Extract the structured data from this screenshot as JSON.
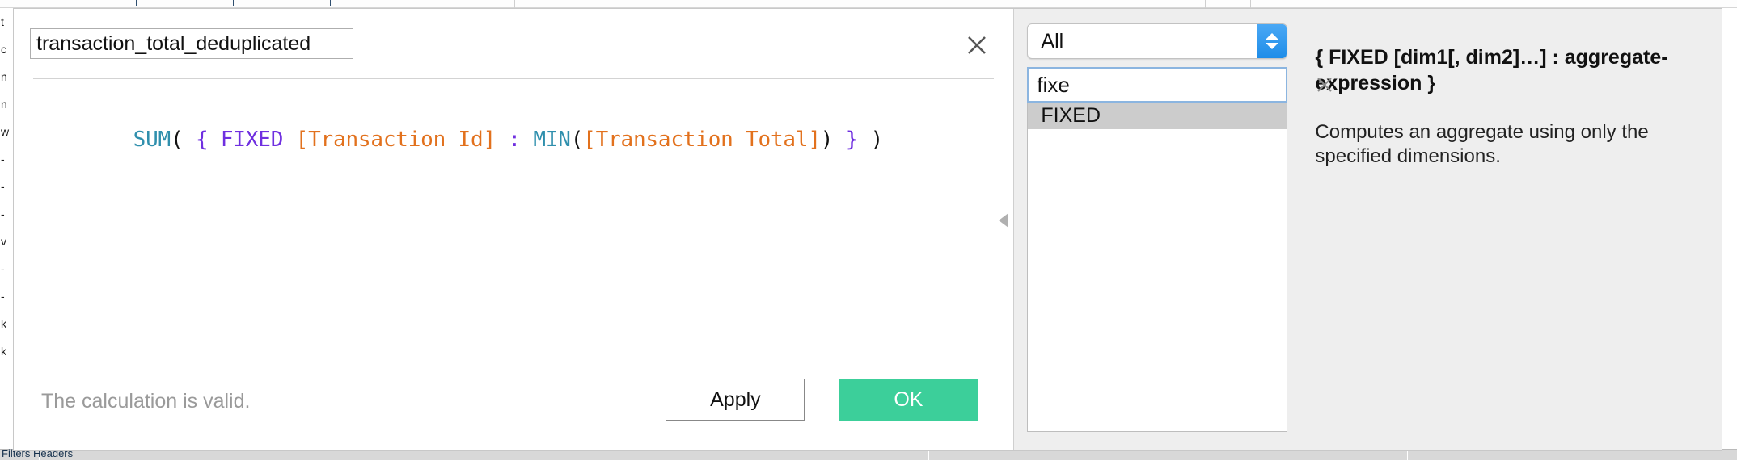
{
  "background": {
    "left_column_fragments": [
      "t",
      "c",
      "n",
      "n",
      "w",
      "-",
      "-",
      "-",
      "v",
      "-",
      "-",
      "k",
      "k"
    ],
    "bottom_label": "Filters Headers"
  },
  "dialog": {
    "name_field": {
      "value": "transaction_total_deduplicated",
      "placeholder": "Calculation name"
    },
    "close_icon": "close-icon",
    "collapse_icon": "collapse-left-arrow-icon",
    "formula": {
      "tokens": [
        {
          "text": "SUM",
          "type": "func"
        },
        {
          "text": "(",
          "type": "punct"
        },
        {
          "text": " ",
          "type": "punct"
        },
        {
          "text": "{",
          "type": "kw"
        },
        {
          "text": " ",
          "type": "punct"
        },
        {
          "text": "FIXED",
          "type": "kw"
        },
        {
          "text": " ",
          "type": "punct"
        },
        {
          "text": "[Transaction Id]",
          "type": "field"
        },
        {
          "text": " ",
          "type": "punct"
        },
        {
          "text": ":",
          "type": "colon"
        },
        {
          "text": " ",
          "type": "punct"
        },
        {
          "text": "MIN",
          "type": "func"
        },
        {
          "text": "(",
          "type": "punct"
        },
        {
          "text": "[Transaction Total]",
          "type": "field"
        },
        {
          "text": ")",
          "type": "punct"
        },
        {
          "text": " ",
          "type": "punct"
        },
        {
          "text": "}",
          "type": "kw"
        },
        {
          "text": " ",
          "type": "punct"
        },
        {
          "text": ")",
          "type": "punct"
        }
      ],
      "plain_text": "SUM( { FIXED [Transaction Id] : MIN([Transaction Total]) } )"
    },
    "footer": {
      "status": "The calculation is valid.",
      "apply_label": "Apply",
      "ok_label": "OK"
    }
  },
  "reference": {
    "category_select": {
      "value": "All",
      "options": [
        "All"
      ],
      "stepper_icon": "stepper-updown-icon"
    },
    "search": {
      "value": "fixe",
      "placeholder": "Search",
      "clear_icon": "clear-icon"
    },
    "function_list": [
      {
        "label": "FIXED",
        "selected": true
      }
    ],
    "help": {
      "signature": "{ FIXED [dim1[, dim2]…] : aggregate-expression }",
      "description": "Computes an aggregate using only the specified dimensions."
    }
  },
  "colors": {
    "ok_button": "#3ccf9a",
    "stepper_blue": "#1e8de8",
    "token_func": "#2f8fad",
    "token_keyword": "#6f2fe0",
    "token_field": "#e2711d",
    "selected_row": "#cccccc",
    "panel_background": "#eeeeee"
  }
}
